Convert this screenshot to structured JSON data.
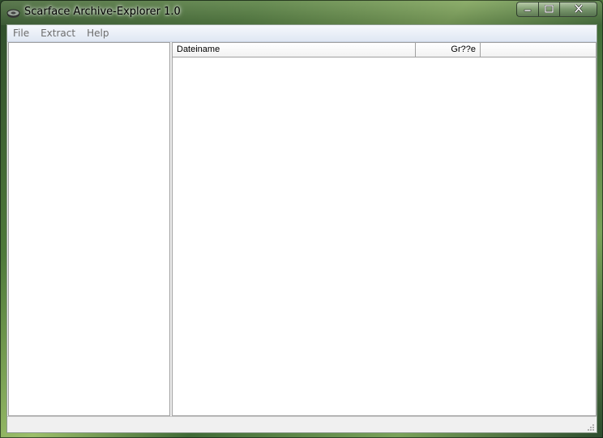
{
  "window": {
    "title": "Scarface Archive-Explorer 1.0",
    "icons": {
      "app": "archive-app-icon",
      "minimize": "minimize-icon",
      "maximize": "maximize-icon",
      "close": "close-icon"
    }
  },
  "menubar": {
    "items": [
      {
        "label": "File"
      },
      {
        "label": "Extract"
      },
      {
        "label": "Help"
      }
    ]
  },
  "file_list": {
    "columns": [
      {
        "label": "Dateiname"
      },
      {
        "label": "Gr??e"
      }
    ],
    "rows": []
  },
  "tree": {
    "items": []
  }
}
